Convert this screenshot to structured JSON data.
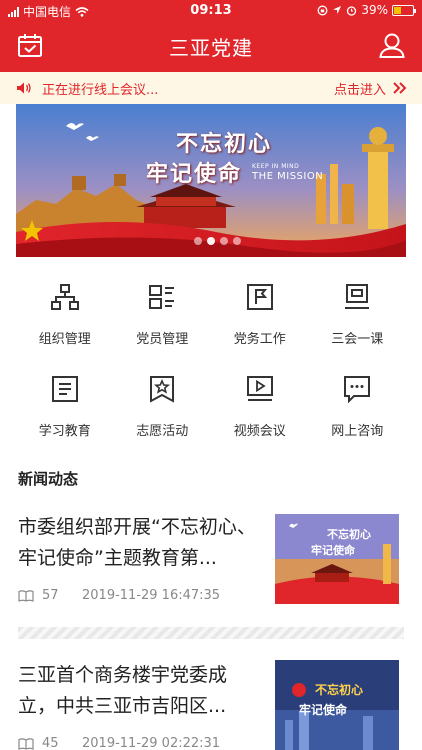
{
  "status_bar": {
    "carrier": "中国电信",
    "time": "09:13",
    "battery": "39%",
    "battery_level": 0.39
  },
  "header": {
    "title": "三亚党建"
  },
  "notice": {
    "text": "正在进行线上会议...",
    "action": "点击进入"
  },
  "banner": {
    "slogan_line1": "不忘初心",
    "slogan_line2": "牢记使命",
    "english_small": "KEEP IN MIND",
    "english_large": "THE MISSION",
    "slide_count": 4,
    "active_slide": 1
  },
  "menu": [
    {
      "label": "组织管理",
      "icon": "org-chart-icon"
    },
    {
      "label": "党员管理",
      "icon": "member-list-icon"
    },
    {
      "label": "党务工作",
      "icon": "flag-icon"
    },
    {
      "label": "三会一课",
      "icon": "monitor-icon"
    },
    {
      "label": "学习教育",
      "icon": "document-icon"
    },
    {
      "label": "志愿活动",
      "icon": "star-bookmark-icon"
    },
    {
      "label": "视频会议",
      "icon": "video-play-icon"
    },
    {
      "label": "网上咨询",
      "icon": "chat-icon"
    }
  ],
  "news": {
    "section_title": "新闻动态",
    "items": [
      {
        "headline": "市委组织部开展“不忘初心、牢记使命”主题教育第...",
        "views": "57",
        "time": "2019-11-29 16:47:35"
      },
      {
        "headline": "三亚首个商务楼宇党委成立，中共三亚市吉阳区...",
        "views": "45",
        "time": "2019-11-29 02:22:31"
      }
    ]
  },
  "colors": {
    "brand_red": "#e0252b",
    "notice_bg": "#fff7e5"
  }
}
